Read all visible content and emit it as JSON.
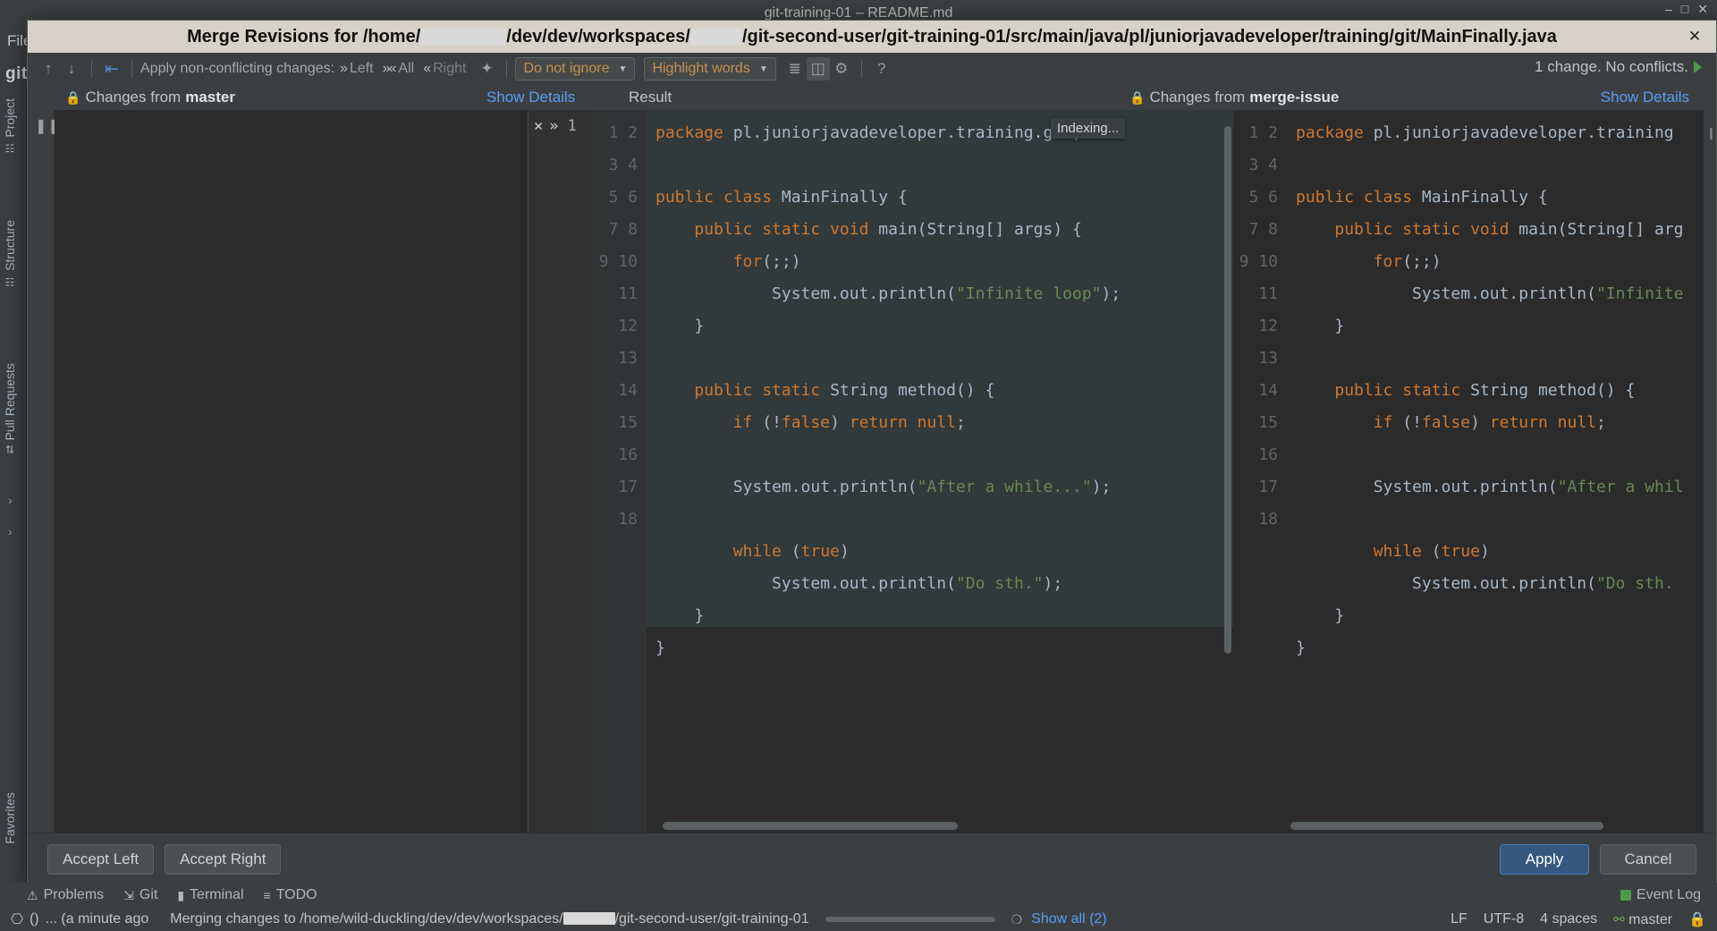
{
  "ide": {
    "window_title": "git-training-01 – README.md",
    "menu_items": [
      "File"
    ],
    "project_label": "git",
    "left_tabs": [
      "Project",
      "Structure",
      "Pull Requests",
      "Favorites"
    ],
    "tool_windows": [
      {
        "label": "Problems",
        "icon": "error-icon"
      },
      {
        "label": "Git",
        "icon": "git-branch-icon"
      },
      {
        "label": "Terminal",
        "icon": "terminal-icon"
      },
      {
        "label": "TODO",
        "icon": "list-icon"
      }
    ],
    "event_log": "Event Log",
    "status": {
      "left_note": "... (a minute ago",
      "message": "Merging changes to /home/wild-duckling/dev/dev/workspaces/",
      "message_tail": "/git-second-user/git-training-01",
      "show_all": "Show all (2)",
      "line_separator": "LF",
      "encoding": "UTF-8",
      "indent": "4 spaces",
      "branch": "master"
    }
  },
  "dialog": {
    "title_prefix": "Merge Revisions for /home/",
    "title_mid": "/dev/dev/workspaces/",
    "title_suffix": "/git-second-user/git-training-01/src/main/java/pl/juniorjavadeveloper/training/git/MainFinally.java",
    "close_icon": "close-icon",
    "toolbar": {
      "prev_icon": "arrow-up-icon",
      "next_icon": "arrow-down-icon",
      "apply_icon": "apply-left-icon",
      "apply_label": "Apply non-conflicting changes:",
      "apply_left": "Left",
      "apply_all": "All",
      "apply_right": "Right",
      "magic_icon": "magic-wand-icon",
      "ignore_select": "Do not ignore",
      "highlight_select": "Highlight words",
      "collapse_icon": "collapse-lines-icon",
      "sidebyside_icon": "side-by-side-icon",
      "settings_icon": "gear-icon",
      "help_icon": "help-icon",
      "conflict_status": "1 change. No conflicts."
    },
    "headers": {
      "left_prefix": "Changes from ",
      "left_branch": "master",
      "left_details": "Show Details",
      "result": "Result",
      "right_prefix": "Changes from ",
      "right_branch": "merge-issue",
      "right_details": "Show Details",
      "lock_icon": "lock-icon"
    },
    "merge_gutter": {
      "reject_icon": "close-icon",
      "accept_icon": "double-chevron-right-icon",
      "change_number": "1"
    },
    "indexing_tooltip": "Indexing...",
    "pause_icon": "pause-icon",
    "left_pane_lines": [
      "",
      "",
      "",
      "",
      "",
      "",
      "",
      "",
      "",
      "",
      "",
      "",
      "",
      "",
      "",
      "",
      "",
      ""
    ],
    "result_line_numbers": [
      "1",
      "2",
      "3",
      "4",
      "5",
      "6",
      "7",
      "8",
      "9",
      "10",
      "11",
      "12",
      "13",
      "14",
      "15",
      "16",
      "17",
      "18"
    ],
    "right_line_numbers": [
      "1",
      "2",
      "3",
      "4",
      "5",
      "6",
      "7",
      "8",
      "9",
      "10",
      "11",
      "12",
      "13",
      "14",
      "15",
      "16",
      "17",
      "18"
    ],
    "result_code": "package pl.juniorjavadeveloper.\n\npublic class MainFinally {\n    public static void main(String[] ar\n        for(;;)\n            System.out.println(\"Infinit\n    }\n\n    public static String method() {\n        if (!false) return null;\n\n        System.out.println(\"After a whi\n\n        while (true)\n            System.out.println(\"Do sth.\n    }\n}\n",
    "right_code": "package pl.juniorjavadeveloper.training\n\npublic class MainFinally {\n    public static void main(String[] arg\n        for(;;)\n            System.out.println(\"Infinite\n    }\n\n    public static String method() {\n        if (!false) return null;\n\n        System.out.println(\"After a whil\n\n        while (true)\n            System.out.println(\"Do sth.\n    }\n}\n",
    "buttons": {
      "accept_left": "Accept Left",
      "accept_right": "Accept Right",
      "apply": "Apply",
      "cancel": "Cancel"
    }
  }
}
